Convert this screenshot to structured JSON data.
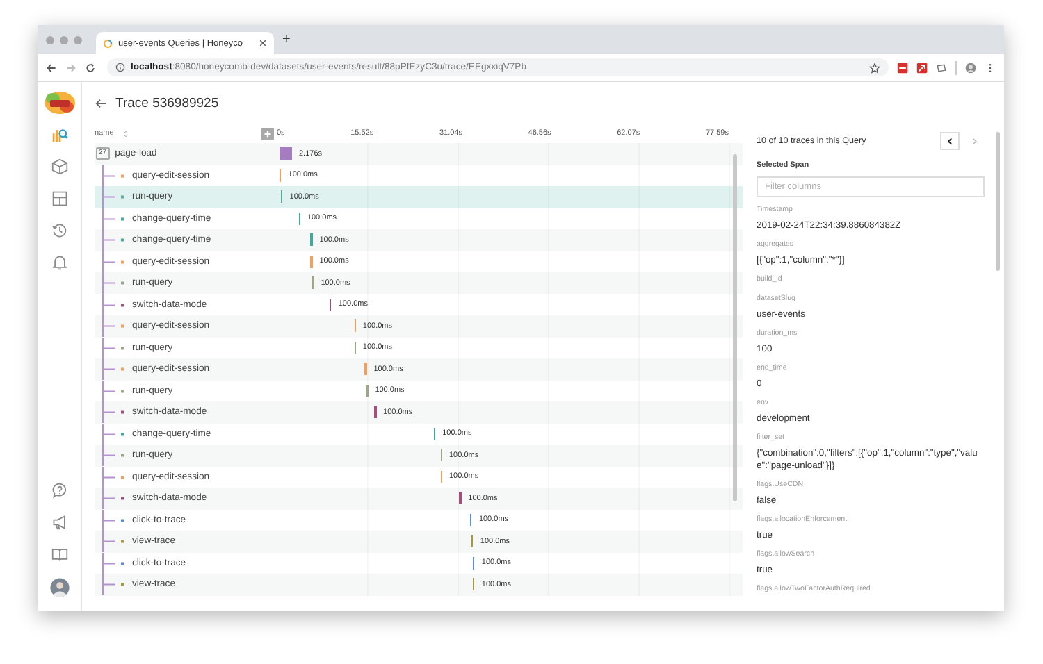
{
  "browser": {
    "tab_title": "user-events Queries | Honeyco",
    "new_tab": "+",
    "url": "**localhost**:8080/honeycomb-dev/datasets/user-events/result/88pPfEzyC3u/trace/EEgxxiqV7Pb"
  },
  "sidebar": {
    "nav": [
      {
        "kind": "query",
        "selected": true
      },
      {
        "kind": "datasets",
        "selected": false
      },
      {
        "kind": "boards",
        "selected": false
      },
      {
        "kind": "history",
        "selected": false
      },
      {
        "kind": "triggers",
        "selected": false
      }
    ],
    "footer": [
      {
        "kind": "help"
      },
      {
        "kind": "news"
      },
      {
        "kind": "docs"
      },
      {
        "kind": "avatar"
      }
    ]
  },
  "trace": {
    "title": "Trace 536989925",
    "name_header": "name",
    "ticks": [
      "0s",
      "15.52s",
      "31.04s",
      "46.56s",
      "62.07s",
      "77.59s"
    ],
    "root": {
      "name": "page-load",
      "count": "27",
      "duration": "2.176s",
      "color": "#a57cc0"
    },
    "spans": [
      {
        "name": "query-edit-session",
        "duration": "100.0ms",
        "color": "#f0a060",
        "selected": false
      },
      {
        "name": "run-query",
        "duration": "100.0ms",
        "color": "#5aa89a",
        "selected": true
      },
      {
        "name": "change-query-time",
        "duration": "100.0ms",
        "color": "#3fa99a",
        "selected": false
      },
      {
        "name": "change-query-time",
        "duration": "100.0ms",
        "color": "#3fa99a",
        "selected": false
      },
      {
        "name": "query-edit-session",
        "duration": "100.0ms",
        "color": "#f0a060",
        "selected": false
      },
      {
        "name": "run-query",
        "duration": "100.0ms",
        "color": "#9aa58a",
        "selected": false
      },
      {
        "name": "switch-data-mode",
        "duration": "100.0ms",
        "color": "#a0507a",
        "selected": false
      },
      {
        "name": "query-edit-session",
        "duration": "100.0ms",
        "color": "#f0a060",
        "selected": false
      },
      {
        "name": "run-query",
        "duration": "100.0ms",
        "color": "#9aa58a",
        "selected": false
      },
      {
        "name": "query-edit-session",
        "duration": "100.0ms",
        "color": "#f0a060",
        "selected": false
      },
      {
        "name": "run-query",
        "duration": "100.0ms",
        "color": "#9aa58a",
        "selected": false
      },
      {
        "name": "switch-data-mode",
        "duration": "100.0ms",
        "color": "#a0507a",
        "selected": false
      },
      {
        "name": "change-query-time",
        "duration": "100.0ms",
        "color": "#3fa99a",
        "selected": false
      },
      {
        "name": "run-query",
        "duration": "100.0ms",
        "color": "#9aa58a",
        "selected": false
      },
      {
        "name": "query-edit-session",
        "duration": "100.0ms",
        "color": "#f0a060",
        "selected": false
      },
      {
        "name": "switch-data-mode",
        "duration": "100.0ms",
        "color": "#a0507a",
        "selected": false
      },
      {
        "name": "click-to-trace",
        "duration": "100.0ms",
        "color": "#5b8fd8",
        "selected": false
      },
      {
        "name": "view-trace",
        "duration": "100.0ms",
        "color": "#a09a40",
        "selected": false
      },
      {
        "name": "click-to-trace",
        "duration": "100.0ms",
        "color": "#5b8fd8",
        "selected": false
      },
      {
        "name": "view-trace",
        "duration": "100.0ms",
        "color": "#a09a40",
        "selected": false
      }
    ]
  },
  "panel": {
    "count": "10 of 10 traces in this Query",
    "prev": {
      "label": "‹",
      "disabled": false
    },
    "next": {
      "label": "›",
      "disabled": true
    },
    "heading": "Selected Span",
    "filter": {
      "placeholder": "Filter columns"
    },
    "fields": [
      {
        "key": "Timestamp",
        "value": "2019-02-24T22:34:39.886084382Z"
      },
      {
        "key": "aggregates",
        "value": "[{\"op\":1,\"column\":\"*\"}]"
      },
      {
        "key": "build_id"
      },
      {
        "key": "datasetSlug",
        "value": "user-events"
      },
      {
        "key": "duration_ms",
        "value": "100"
      },
      {
        "key": "end_time",
        "value": "0"
      },
      {
        "key": "env",
        "value": "development"
      },
      {
        "key": "filter_set",
        "value": "{\"combination\":0,\"filters\":[{\"op\":1,\"column\":\"type\",\"value\":\"page-unload\"}]}"
      },
      {
        "key": "flags.UseCDN",
        "value": "false"
      },
      {
        "key": "flags.allocationEnforcement",
        "value": "true"
      },
      {
        "key": "flags.allowSearch",
        "value": "true"
      },
      {
        "key": "flags.allowTwoFactorAuthRequired"
      }
    ]
  }
}
